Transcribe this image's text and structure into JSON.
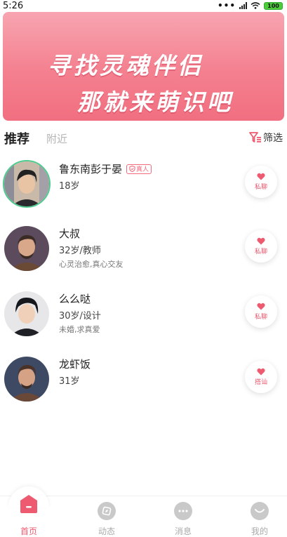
{
  "status_bar": {
    "time": "5:26",
    "battery": "100"
  },
  "banner": {
    "line1": "寻找灵魂伴侣",
    "line2": "那就来萌识吧"
  },
  "tabs": {
    "recommend": "推荐",
    "nearby": "附近"
  },
  "filter_label": "筛选",
  "users": [
    {
      "name": "鲁东南彭于晏",
      "badge": "真人",
      "meta": "18岁",
      "tags": "",
      "action": "私聊"
    },
    {
      "name": "大叔",
      "badge": "",
      "meta": "32岁/教师",
      "tags": "心灵治愈,真心交友",
      "action": "私聊"
    },
    {
      "name": "么么哒",
      "badge": "",
      "meta": "30岁/设计",
      "tags": "未婚,求真爱",
      "action": "私聊"
    },
    {
      "name": "龙虾饭",
      "badge": "",
      "meta": "31岁",
      "tags": "",
      "action": "搭讪"
    }
  ],
  "nav": {
    "home": "首页",
    "moments": "动态",
    "messages": "消息",
    "me": "我的"
  },
  "colors": {
    "accent": "#ee5a6f",
    "banner": "#f4808f",
    "online_ring": "#4ecb8e"
  }
}
